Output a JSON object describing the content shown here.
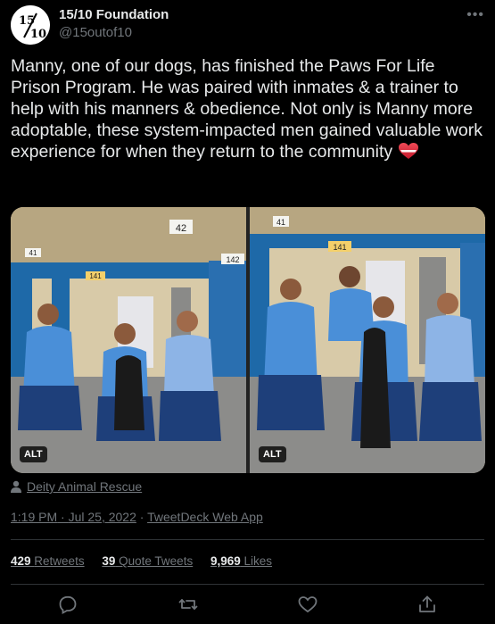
{
  "account": {
    "display_name": "15/10 Foundation",
    "handle": "@15outof10",
    "avatar_text_top": "15",
    "avatar_text_bottom": "10"
  },
  "tweet": {
    "text": "Manny, one of our dogs, has finished the Paws For Life Prison Program. He was paired with inmates & a trainer to help with his manners & obedience. Not only is Manny more adoptable, these system-impacted men gained valuable work experience for when they return to the community",
    "emoji": "heart-emoji"
  },
  "media": {
    "left_photo": {
      "alt_badge": "ALT",
      "signs": [
        "42",
        "142",
        "141",
        "41"
      ]
    },
    "right_photo": {
      "alt_badge": "ALT",
      "signs": [
        "41",
        "141"
      ]
    }
  },
  "credit": {
    "label": "Deity Animal Rescue"
  },
  "meta": {
    "time": "1:19 PM",
    "date": "Jul 25, 2022",
    "source": "TweetDeck Web App"
  },
  "stats": {
    "retweets_count": "429",
    "retweets_label": "Retweets",
    "quotes_count": "39",
    "quotes_label": "Quote Tweets",
    "likes_count": "9,969",
    "likes_label": "Likes"
  },
  "colors": {
    "background": "#000000",
    "text": "#e7e9ea",
    "muted": "#71767b",
    "divider": "#2f3336"
  }
}
